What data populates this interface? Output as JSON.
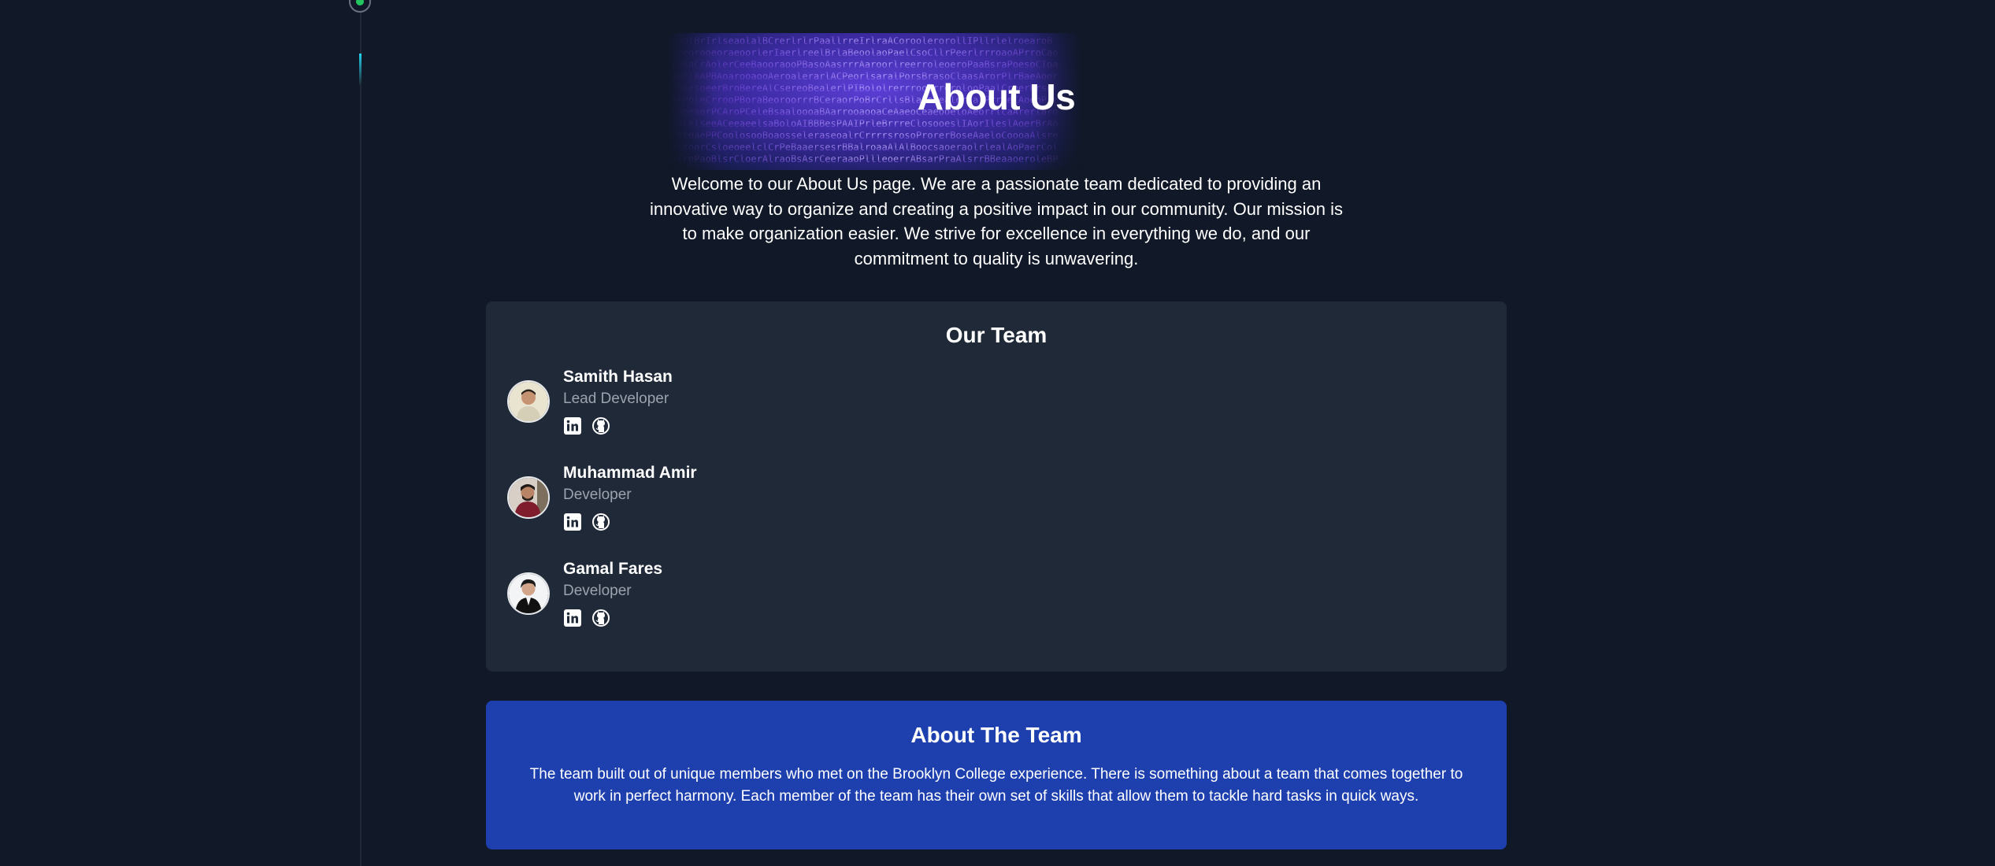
{
  "hero": {
    "title": "About Us",
    "intro": "Welcome to our About Us page. We are a passionate team dedicated to providing an innovative way to organize and creating a positive impact in our community. Our mission is to make organization easier. We strive for excellence in everything we do, and our commitment to quality is unwavering."
  },
  "team": {
    "heading": "Our Team",
    "members": [
      {
        "name": "Samith Hasan",
        "role": "Lead Developer"
      },
      {
        "name": "Muhammad Amir",
        "role": "Developer"
      },
      {
        "name": "Gamal Fares",
        "role": "Developer"
      }
    ]
  },
  "about_team": {
    "heading": "About The Team",
    "text": "The team built out of unique members who met on the Brooklyn College experience. There is something about a team that comes together to work in perfect harmony. Each member of the team has their own set of skills that allow them to tackle hard tasks in quick ways."
  },
  "colors": {
    "background": "#111827",
    "card": "#1f2937",
    "about_team_card": "#1e40af",
    "muted_text": "#9ca3af",
    "timeline_dot": "#22c55e"
  },
  "icons": {
    "linkedin": "linkedin-icon",
    "github": "github-icon"
  }
}
